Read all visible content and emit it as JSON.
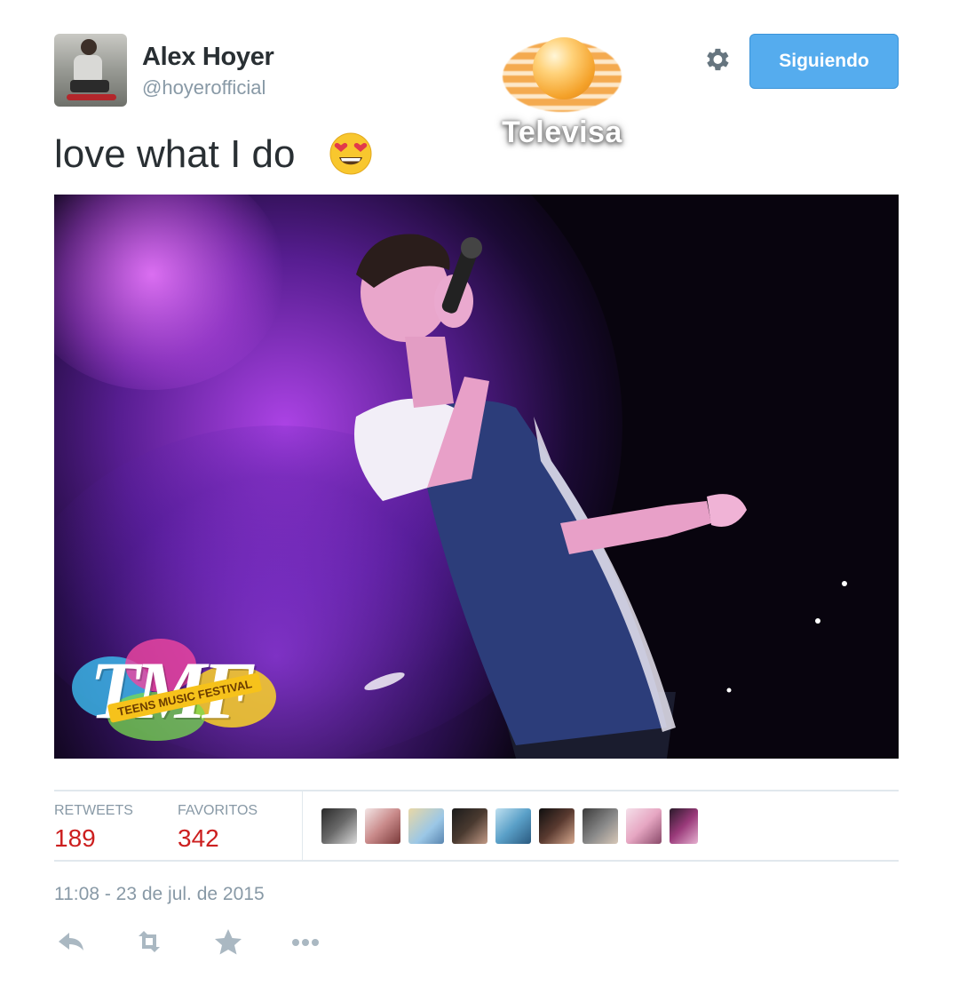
{
  "user": {
    "name": "Alex Hoyer",
    "handle": "@hoyerofficial",
    "avatar_icon": "user-avatar"
  },
  "watermark": {
    "text": "Televisa"
  },
  "header": {
    "settings_icon": "gear-icon",
    "follow_label": "Siguiendo",
    "follow_color": "#55acee"
  },
  "tweet": {
    "text": "love what I do",
    "emoji_icon": "heart-eyes-emoji"
  },
  "media": {
    "logo_text": "TMF",
    "logo_banner": "TEENS MUSIC FESTIVAL"
  },
  "stats": {
    "retweets_label": "RETWEETS",
    "retweets_value": "189",
    "favorites_label": "FAVORITOS",
    "favorites_value": "342",
    "value_color": "#cc1f1f",
    "faces_count": 9
  },
  "timestamp": "11:08 - 23 de jul. de 2015",
  "actions": {
    "reply_icon": "reply-icon",
    "retweet_icon": "retweet-icon",
    "favorite_icon": "star-icon",
    "more_icon": "more-icon"
  }
}
